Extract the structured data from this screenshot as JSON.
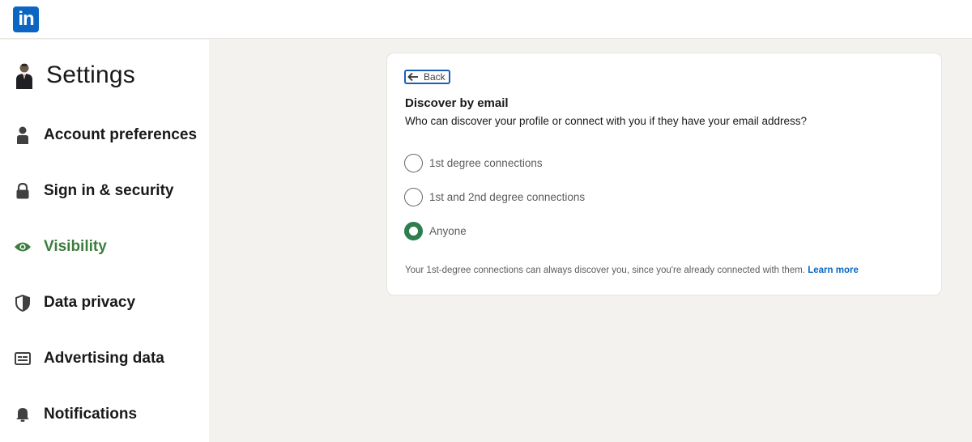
{
  "brand": {
    "logo_text": "in",
    "color": "#0a66c2"
  },
  "sidebar": {
    "title": "Settings",
    "items": [
      {
        "label": "Account preferences",
        "icon": "person-icon",
        "active": false
      },
      {
        "label": "Sign in & security",
        "icon": "lock-icon",
        "active": false
      },
      {
        "label": "Visibility",
        "icon": "eye-icon",
        "active": true
      },
      {
        "label": "Data privacy",
        "icon": "shield-icon",
        "active": false
      },
      {
        "label": "Advertising data",
        "icon": "ad-icon",
        "active": false
      },
      {
        "label": "Notifications",
        "icon": "bell-icon",
        "active": false
      }
    ],
    "active_color": "#3e7d3e"
  },
  "card": {
    "back_label": "Back",
    "title": "Discover by email",
    "description": "Who can discover your profile or connect with you if they have your email address?",
    "options": [
      {
        "label": "1st degree connections",
        "selected": false
      },
      {
        "label": "1st and 2nd degree connections",
        "selected": false
      },
      {
        "label": "Anyone",
        "selected": true
      }
    ],
    "note": "Your 1st-degree connections can always discover you, since you're already connected with them.",
    "learn_more": "Learn more"
  }
}
